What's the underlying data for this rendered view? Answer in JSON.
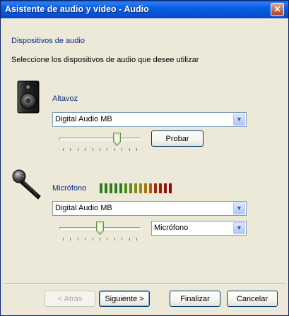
{
  "window": {
    "title": "Asistente de audio y vídeo - Audio",
    "close_label": "✕"
  },
  "header": {
    "section_title": "Dispositivos de audio",
    "instruction": "Seleccione los dispositivos de audio que desee utilizar"
  },
  "speaker": {
    "label": "Altavoz",
    "icon": "speaker-icon",
    "device": "Digital Audio MB",
    "test_button": "Probar",
    "volume_level": 0.73
  },
  "microphone": {
    "label": "Micrófono",
    "icon": "microphone-icon",
    "device": "Digital Audio MB",
    "input_source": "Micrófono",
    "volume_level": 0.5,
    "level_meter": {
      "segments": 15,
      "colors": [
        "#2e7d1c",
        "#2e7d1c",
        "#2e7d1c",
        "#2e7d1c",
        "#2e7d1c",
        "#4e8a14",
        "#5e8c12",
        "#7e8f10",
        "#9c8a0e",
        "#a8780c",
        "#b05a0a",
        "#a8280a",
        "#a0180a",
        "#980e08",
        "#900808"
      ]
    }
  },
  "footer": {
    "back": "< Atrás",
    "next": "Siguiente >",
    "finish": "Finalizar",
    "cancel": "Cancelar"
  }
}
